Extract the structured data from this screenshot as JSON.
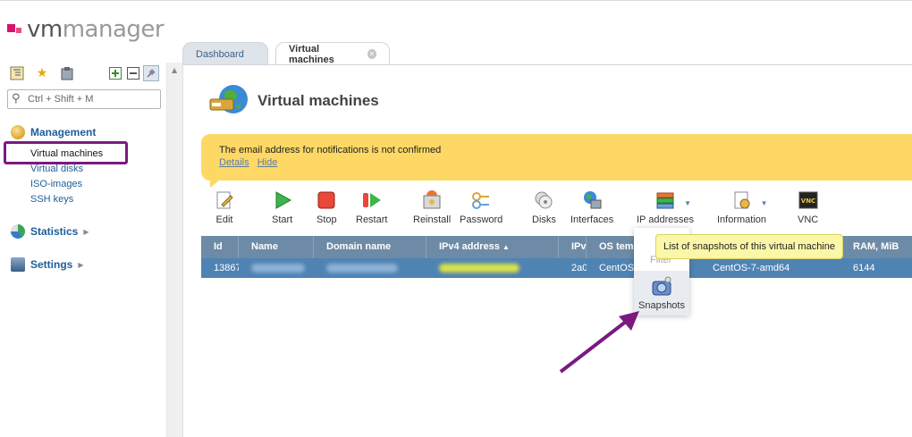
{
  "logo": {
    "vm": "vm",
    "manager": "manager"
  },
  "sidebar": {
    "search_placeholder": "Ctrl + Shift + M",
    "sections": [
      {
        "title": "Management",
        "items": [
          "Virtual machines",
          "Virtual disks",
          "ISO-images",
          "SSH keys"
        ]
      },
      {
        "title": "Statistics"
      },
      {
        "title": "Settings"
      }
    ]
  },
  "tabs": {
    "dashboard": "Dashboard",
    "virtual_machines": "Virtual machines"
  },
  "page": {
    "title": "Virtual machines"
  },
  "banner": {
    "message": "The email address for notifications is not confirmed",
    "details": "Details",
    "hide": "Hide"
  },
  "toolbar": {
    "edit": "Edit",
    "start": "Start",
    "stop": "Stop",
    "restart": "Restart",
    "reinstall": "Reinstall",
    "password": "Password",
    "disks": "Disks",
    "interfaces": "Interfaces",
    "ip_addresses": "IP addresses",
    "information": "Information",
    "vnc": "VNC"
  },
  "table": {
    "columns": [
      "Id",
      "Name",
      "Domain name",
      "IPv4 address",
      "IPv",
      "OS tem",
      "RAM, MiB"
    ],
    "rows": [
      {
        "id": "13867",
        "ipv6": "2a0",
        "os_short": "CentOS",
        "os_template": "CentOS-7-amd64",
        "ram": "6144"
      }
    ]
  },
  "dropdown": {
    "filter": "Filter",
    "snapshots": "Snapshots"
  },
  "tooltip": {
    "text": "List of snapshots of this virtual machine"
  },
  "colors": {
    "accent": "#1e5e99",
    "banner": "#fdd865",
    "header": "#6d8ba6",
    "selected_row": "#4f83b3",
    "annotation": "#7a1a80"
  }
}
